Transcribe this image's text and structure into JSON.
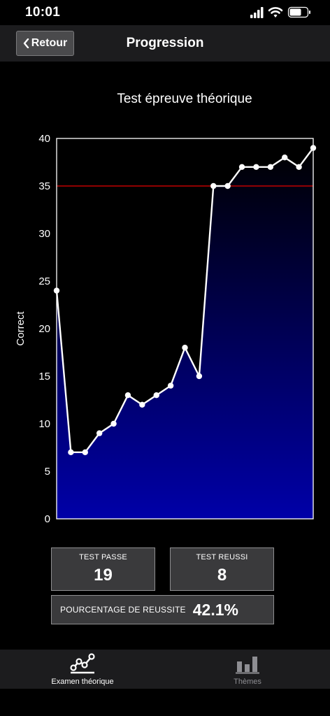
{
  "status": {
    "time": "10:01"
  },
  "nav": {
    "back_label": "Retour",
    "title": "Progression"
  },
  "colors": {
    "background": "#000000",
    "bar_bg": "#1c1c1e",
    "box_bg": "#3a3a3c",
    "area_top": "#000000",
    "area_bottom": "#0000a8",
    "threshold_line": "#c00000",
    "line": "#ffffff",
    "tab_active": "#ffffff",
    "tab_inactive": "#8e8e93"
  },
  "chart_data": {
    "type": "area",
    "title": "Test épreuve théorique",
    "xlabel": "",
    "ylabel": "Correct",
    "ylim": [
      0,
      40
    ],
    "yticks": [
      0,
      5,
      10,
      15,
      20,
      25,
      30,
      35,
      40
    ],
    "x": [
      1,
      2,
      3,
      4,
      5,
      6,
      7,
      8,
      9,
      10,
      11,
      12,
      13,
      14,
      15,
      16,
      17,
      18,
      19
    ],
    "values": [
      24,
      7,
      7,
      9,
      10,
      13,
      12,
      13,
      14,
      18,
      15,
      35,
      35,
      37,
      37,
      37,
      38,
      37,
      39
    ],
    "threshold": 35,
    "grid": false,
    "legend": "none"
  },
  "stats": {
    "passed_label": "TEST PASSE",
    "passed_value": "19",
    "success_label": "TEST REUSSI",
    "success_value": "8",
    "pct_label": "POURCENTAGE DE REUSSITE",
    "pct_value": "42.1%"
  },
  "tabs": [
    {
      "label": "Examen théorique",
      "icon": "line-chart-icon",
      "active": true
    },
    {
      "label": "Thèmes",
      "icon": "bar-chart-icon",
      "active": false
    }
  ]
}
